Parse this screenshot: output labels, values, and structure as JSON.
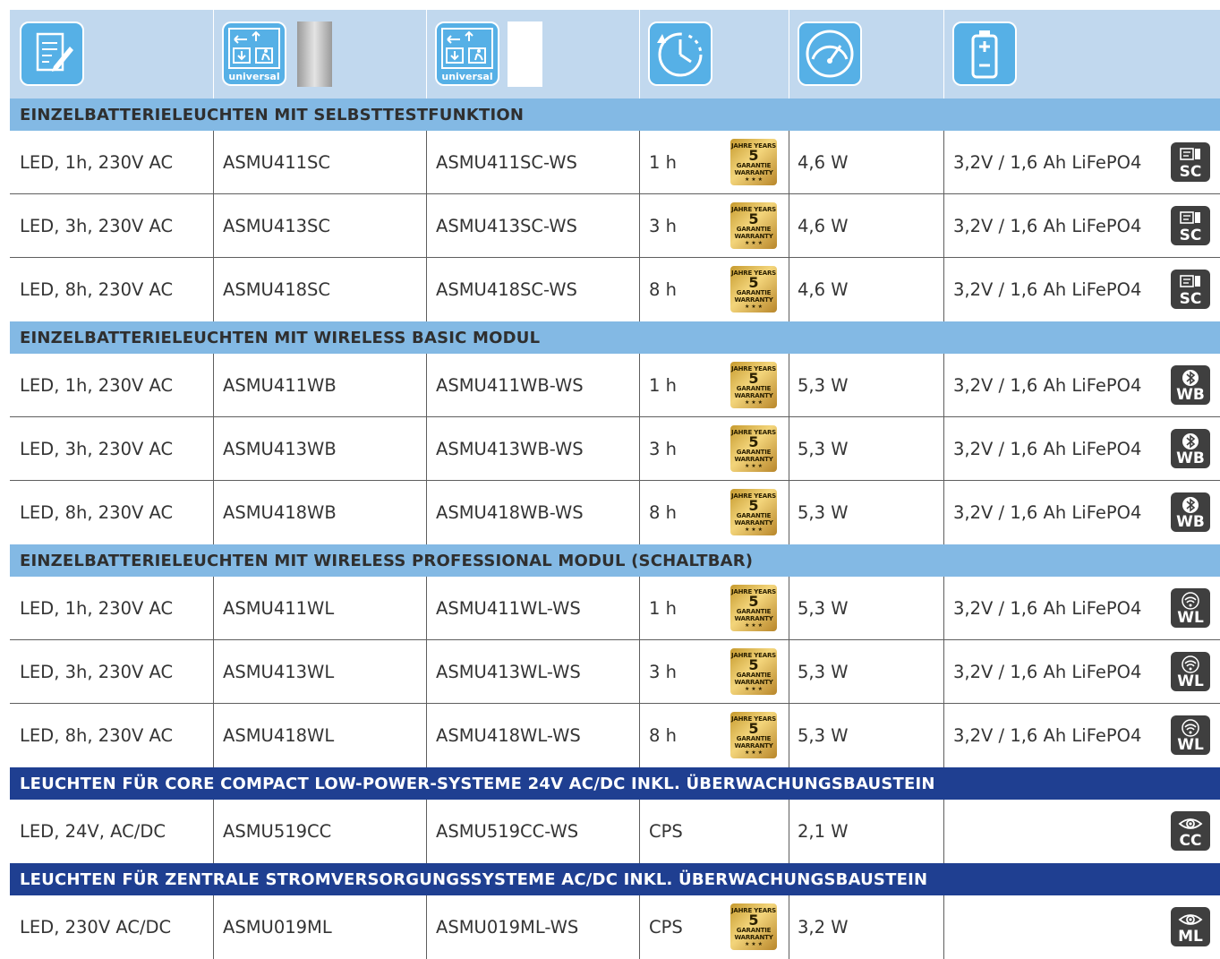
{
  "header": {
    "columns": [
      {
        "icon": "document-edit-icon"
      },
      {
        "icon": "exit-sign-universal-icon",
        "label": "universal",
        "swatch": "silver"
      },
      {
        "icon": "exit-sign-universal-icon",
        "label": "universal",
        "swatch": "white"
      },
      {
        "icon": "clock-duration-icon"
      },
      {
        "icon": "power-gauge-icon"
      },
      {
        "icon": "battery-icon"
      }
    ]
  },
  "warranty": {
    "number": "5",
    "top": "JAHRE YEARS",
    "line1": "GARANTIE",
    "line2": "WARRANTY",
    "stars": "★ ★ ★"
  },
  "sections": [
    {
      "title": "EINZELBATTERIELEUCHTEN MIT SELBSTTESTFUNKTION",
      "style": "light",
      "rows": [
        {
          "desc": "LED, 1h, 230V AC",
          "art1": "ASMU411SC",
          "art2": "ASMU411SC-WS",
          "duration": "1 h",
          "warranty": true,
          "power": "4,6 W",
          "battery": "3,2V / 1,6 Ah LiFePO4",
          "badge": "SC",
          "badge_icon": "selftest-icon"
        },
        {
          "desc": "LED, 3h, 230V AC",
          "art1": "ASMU413SC",
          "art2": "ASMU413SC-WS",
          "duration": "3 h",
          "warranty": true,
          "power": "4,6 W",
          "battery": "3,2V / 1,6 Ah LiFePO4",
          "badge": "SC",
          "badge_icon": "selftest-icon"
        },
        {
          "desc": "LED, 8h, 230V AC",
          "art1": "ASMU418SC",
          "art2": "ASMU418SC-WS",
          "duration": "8 h",
          "warranty": true,
          "power": "4,6 W",
          "battery": "3,2V / 1,6 Ah LiFePO4",
          "badge": "SC",
          "badge_icon": "selftest-icon"
        }
      ]
    },
    {
      "title": "EINZELBATTERIELEUCHTEN MIT WIRELESS BASIC MODUL",
      "style": "light",
      "rows": [
        {
          "desc": "LED, 1h, 230V AC",
          "art1": "ASMU411WB",
          "art2": "ASMU411WB-WS",
          "duration": "1 h",
          "warranty": true,
          "power": "5,3 W",
          "battery": "3,2V / 1,6 Ah LiFePO4",
          "badge": "WB",
          "badge_icon": "bluetooth-icon"
        },
        {
          "desc": "LED, 3h, 230V AC",
          "art1": "ASMU413WB",
          "art2": "ASMU413WB-WS",
          "duration": "3 h",
          "warranty": true,
          "power": "5,3 W",
          "battery": "3,2V / 1,6 Ah LiFePO4",
          "badge": "WB",
          "badge_icon": "bluetooth-icon"
        },
        {
          "desc": "LED, 8h, 230V AC",
          "art1": "ASMU418WB",
          "art2": "ASMU418WB-WS",
          "duration": "8 h",
          "warranty": true,
          "power": "5,3 W",
          "battery": "3,2V / 1,6 Ah LiFePO4",
          "badge": "WB",
          "badge_icon": "bluetooth-icon"
        }
      ]
    },
    {
      "title": "EINZELBATTERIELEUCHTEN MIT WIRELESS PROFESSIONAL MODUL (SCHALTBAR)",
      "style": "light",
      "rows": [
        {
          "desc": "LED, 1h, 230V AC",
          "art1": "ASMU411WL",
          "art2": "ASMU411WL-WS",
          "duration": "1 h",
          "warranty": true,
          "power": "5,3 W",
          "battery": "3,2V / 1,6 Ah LiFePO4",
          "badge": "WL",
          "badge_icon": "wifi-icon"
        },
        {
          "desc": "LED, 3h, 230V AC",
          "art1": "ASMU413WL",
          "art2": "ASMU413WL-WS",
          "duration": "3 h",
          "warranty": true,
          "power": "5,3 W",
          "battery": "3,2V / 1,6 Ah LiFePO4",
          "badge": "WL",
          "badge_icon": "wifi-icon"
        },
        {
          "desc": "LED, 8h, 230V AC",
          "art1": "ASMU418WL",
          "art2": "ASMU418WL-WS",
          "duration": "8 h",
          "warranty": true,
          "power": "5,3 W",
          "battery": "3,2V / 1,6 Ah LiFePO4",
          "badge": "WL",
          "badge_icon": "wifi-icon"
        }
      ]
    },
    {
      "title": "LEUCHTEN FÜR CORE COMPACT LOW-POWER-SYSTEME 24V AC/DC INKL. ÜBERWACHUNGSBAUSTEIN",
      "style": "dark",
      "rows": [
        {
          "desc": "LED, 24V, AC/DC",
          "art1": "ASMU519CC",
          "art2": "ASMU519CC-WS",
          "duration": "CPS",
          "warranty": false,
          "power": "2,1 W",
          "battery": "",
          "badge": "CC",
          "badge_icon": "eye-icon"
        }
      ]
    },
    {
      "title": "LEUCHTEN FÜR ZENTRALE STROMVERSORGUNGSSYSTEME AC/DC INKL. ÜBERWACHUNGSBAUSTEIN",
      "style": "dark",
      "rows": [
        {
          "desc": "LED, 230V AC/DC",
          "art1": "ASMU019ML",
          "art2": "ASMU019ML-WS",
          "duration": "CPS",
          "warranty": true,
          "power": "3,2 W",
          "battery": "",
          "badge": "ML",
          "badge_icon": "eye-icon"
        }
      ]
    }
  ]
}
